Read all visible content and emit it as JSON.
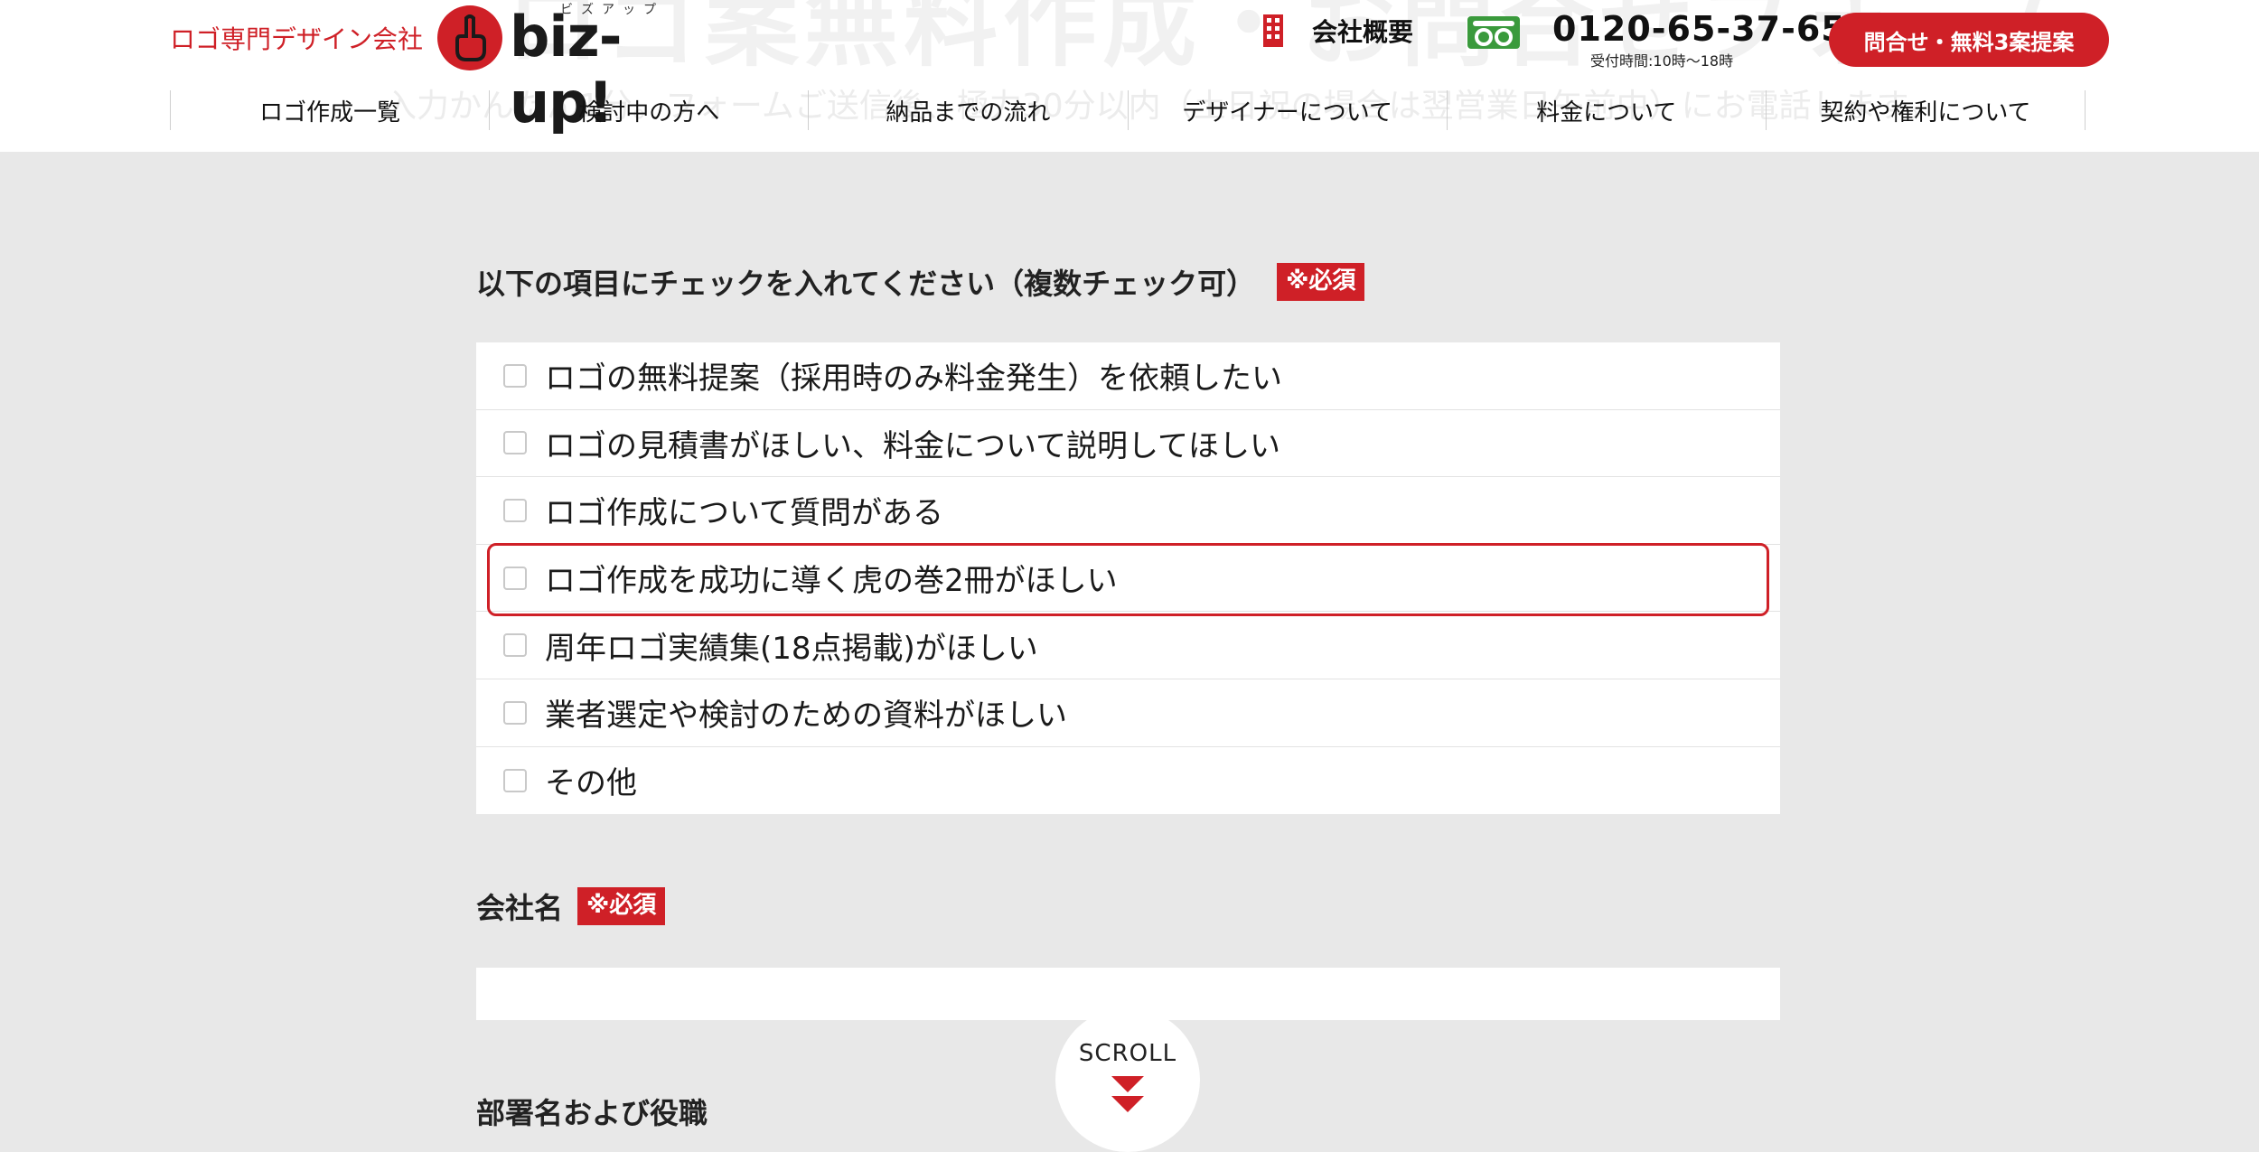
{
  "header": {
    "ghost_title": "ロゴ案無料作成・お問合せフォーム",
    "ghost_subtitle": "入力かんたん1分。フォームご送信後、極力30分以内（土日祝の場合は翌営業日午前中）にお電話します。",
    "tagline": "ロゴ専門デザイン会社",
    "logo": {
      "wordmark": "biz-up!",
      "kana": "ビズアップ"
    },
    "company_link": "会社概要",
    "phone": {
      "number": "0120-65-37-65",
      "hours": "受付時間:10時〜18時"
    },
    "cta_label": "問合せ・無料3案提案",
    "nav": [
      "ロゴ作成一覧",
      "検討中の方へ",
      "納品までの流れ",
      "デザイナーについて",
      "料金について",
      "契約や権利について"
    ]
  },
  "form": {
    "checklist_label": "以下の項目にチェックを入れてください（複数チェック可）",
    "required_text": "※必須",
    "options": [
      "ロゴの無料提案（採用時のみ料金発生）を依頼したい",
      "ロゴの見積書がほしい、料金について説明してほしい",
      "ロゴ作成について質問がある",
      "ロゴ作成を成功に導く虎の巻2冊がほしい",
      "周年ロゴ実績集(18点掲載)がほしい",
      "業者選定や検討のための資料がほしい",
      "その他"
    ],
    "company_label": "会社名",
    "company_value": "",
    "department_label": "部署名および役職"
  },
  "scroll_label": "SCROLL",
  "colors": {
    "brand_red": "#cf2027",
    "background": "#e8e8e8",
    "freedial_green": "#3a9a3c"
  }
}
